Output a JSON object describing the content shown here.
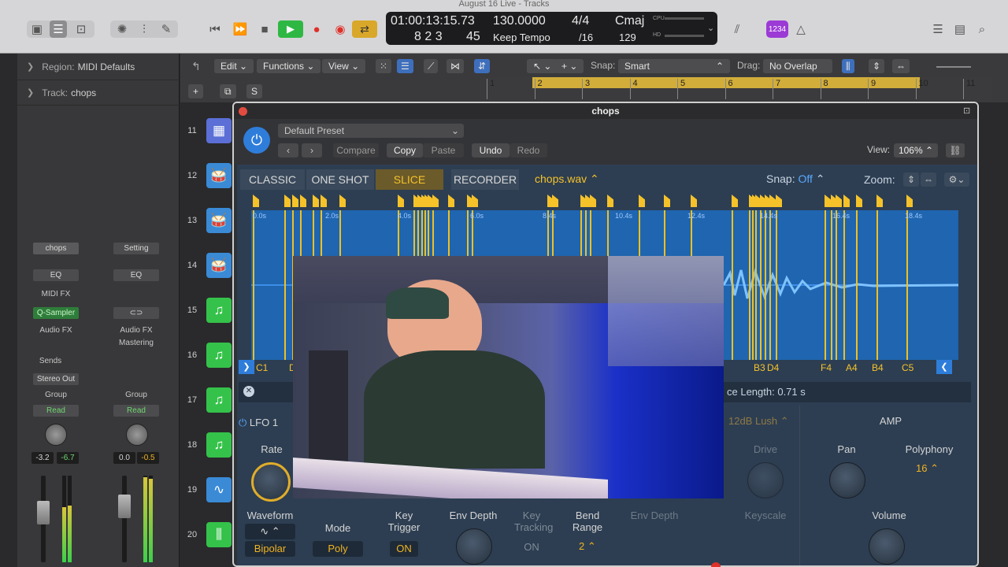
{
  "window": {
    "title": "August 16 Live - Tracks"
  },
  "transport": {
    "position": "01:00:13:15.73",
    "bars": "8 2 3",
    "ticks": "45",
    "tempo": "130.0000",
    "tempo_mode": "Keep Tempo",
    "time_sig": "4/4",
    "division": "/16",
    "key": "Cmaj",
    "key_value": "129",
    "cpu_label": "CPU",
    "hd_label": "HD",
    "count_in": "1234"
  },
  "inspector": {
    "region_label": "Region:",
    "region_value": "MIDI Defaults",
    "track_label": "Track:",
    "track_value": "chops"
  },
  "strip1": {
    "name": "chops",
    "eq": "EQ",
    "midi_fx": "MIDI FX",
    "instrument": "Q-Sampler",
    "audio_fx": "Audio FX",
    "sends": "Sends",
    "output": "Stereo Out",
    "group": "Group",
    "automation": "Read",
    "vol": "-3.2",
    "peak": "-6.7"
  },
  "strip2": {
    "name": "Setting",
    "eq": "EQ",
    "audio_fx": "Audio FX",
    "fx_slot": "Mastering",
    "group": "Group",
    "automation": "Read",
    "vol": "0.0",
    "peak": "-0.5"
  },
  "toolbar": {
    "edit": "Edit",
    "functions": "Functions",
    "view": "View",
    "snap_label": "Snap:",
    "snap_value": "Smart",
    "drag_label": "Drag:",
    "drag_value": "No Overlap",
    "s_btn": "S",
    "plus": "+"
  },
  "ruler": [
    "1",
    "2",
    "3",
    "4",
    "5",
    "6",
    "7",
    "8",
    "9",
    "10",
    "11"
  ],
  "tracks": [
    "11",
    "12",
    "13",
    "14",
    "15",
    "16",
    "17",
    "18",
    "19",
    "20"
  ],
  "plugin": {
    "title": "chops",
    "preset": "Default Preset",
    "compare": "Compare",
    "copy": "Copy",
    "paste": "Paste",
    "undo": "Undo",
    "redo": "Redo",
    "view_label": "View:",
    "view_value": "106%",
    "modes": [
      "CLASSIC",
      "ONE SHOT",
      "SLICE",
      "RECORDER"
    ],
    "file": "chops.wav",
    "snap_label": "Snap:",
    "snap_value": "Off",
    "zoom_label": "Zoom:",
    "time_marks": [
      "0.0s",
      "2.0s",
      "4.0s",
      "6.0s",
      "8.4s",
      "10.4s",
      "12.4s",
      "14.4s",
      "16.4s",
      "18.4s"
    ],
    "notes_left": [
      "C1",
      "D"
    ],
    "notes_right": [
      "B3",
      "D4",
      "F4",
      "A4",
      "B4",
      "C5"
    ],
    "slice_length_label": "ce Length:",
    "slice_length_value": "0.71 s",
    "lfo": "LFO 1",
    "rate": "Rate",
    "waveform": "Waveform",
    "waveform_value": "Bipolar",
    "mode": "Mode",
    "mode_value": "Poly",
    "key_trigger": "Key Trigger",
    "key_trigger_value": "ON",
    "env_depth": "Env Depth",
    "key_tracking": "Key Tracking",
    "key_tracking_value": "ON",
    "bend_range": "Bend Range",
    "bend_value": "2",
    "env_depth2": "Env Depth",
    "filter": "12dB Lush",
    "drive": "Drive",
    "keyscale": "Keyscale",
    "amp": "AMP",
    "pan": "Pan",
    "polyphony": "Polyphony",
    "polyphony_value": "16",
    "volume": "Volume"
  }
}
